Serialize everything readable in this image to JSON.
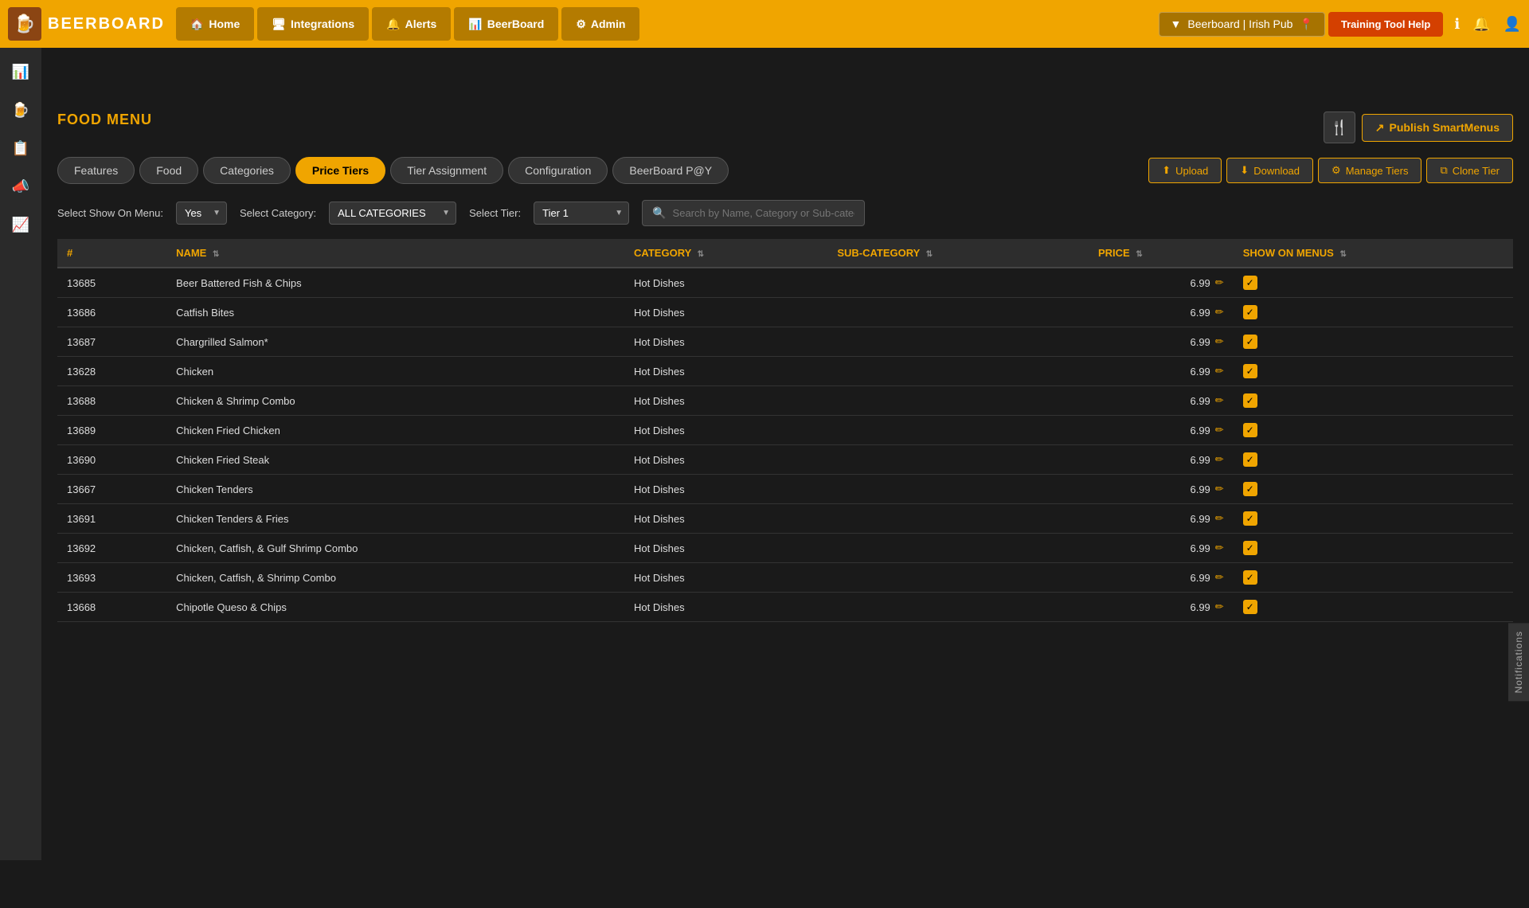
{
  "app": {
    "logo_text": "BEERBOARD",
    "logo_emoji": "🍺"
  },
  "nav": {
    "items": [
      {
        "id": "home",
        "label": "Home",
        "icon": "🏠",
        "active": false
      },
      {
        "id": "integrations",
        "label": "Integrations",
        "icon": "🖥",
        "active": false
      },
      {
        "id": "alerts",
        "label": "Alerts",
        "icon": "🔔",
        "active": false
      },
      {
        "id": "beerboard",
        "label": "BeerBoard",
        "icon": "📊",
        "active": false
      },
      {
        "id": "admin",
        "label": "Admin",
        "icon": "⚙",
        "active": false
      }
    ],
    "venue": "Beerboard | Irish Pub",
    "training_btn": "Training Tool Help",
    "icon_info": "ℹ",
    "icon_bell": "🔔",
    "icon_user": "👤"
  },
  "sidebar": {
    "items": [
      {
        "id": "analytics",
        "icon": "📊"
      },
      {
        "id": "beer",
        "icon": "🍺"
      },
      {
        "id": "reports",
        "icon": "📋"
      },
      {
        "id": "megaphone",
        "icon": "📣"
      },
      {
        "id": "chart",
        "icon": "📈"
      }
    ]
  },
  "page": {
    "title": "FOOD MENU",
    "publish_btn": "Publish SmartMenus",
    "fork_icon": "🍴"
  },
  "tabs": [
    {
      "id": "features",
      "label": "Features",
      "active": false
    },
    {
      "id": "food",
      "label": "Food",
      "active": false
    },
    {
      "id": "categories",
      "label": "Categories",
      "active": false
    },
    {
      "id": "price-tiers",
      "label": "Price Tiers",
      "active": true
    },
    {
      "id": "tier-assignment",
      "label": "Tier Assignment",
      "active": false
    },
    {
      "id": "configuration",
      "label": "Configuration",
      "active": false
    },
    {
      "id": "beerboard-pay",
      "label": "BeerBoard P@Y",
      "active": false
    }
  ],
  "actions": {
    "upload": "Upload",
    "download": "Download",
    "manage_tiers": "Manage Tiers",
    "clone_tier": "Clone Tier"
  },
  "filters": {
    "show_on_menu_label": "Select Show On Menu:",
    "show_on_menu_value": "Yes",
    "category_label": "Select Category:",
    "category_value": "ALL CATEGORIES",
    "tier_label": "Select Tier:",
    "tier_value": "Tier 1",
    "search_placeholder": "Search by Name, Category or Sub-category"
  },
  "table": {
    "columns": [
      {
        "id": "number",
        "label": "#"
      },
      {
        "id": "name",
        "label": "NAME"
      },
      {
        "id": "category",
        "label": "CATEGORY"
      },
      {
        "id": "sub_category",
        "label": "SUB-CATEGORY"
      },
      {
        "id": "price",
        "label": "PRICE"
      },
      {
        "id": "show_on_menus",
        "label": "SHOW ON MENUS"
      }
    ],
    "rows": [
      {
        "id": "13685",
        "name": "Beer Battered Fish & Chips",
        "category": "Hot Dishes",
        "sub_category": "",
        "price": "6.99",
        "show": true
      },
      {
        "id": "13686",
        "name": "Catfish Bites",
        "category": "Hot Dishes",
        "sub_category": "",
        "price": "6.99",
        "show": true
      },
      {
        "id": "13687",
        "name": "Chargrilled Salmon*",
        "category": "Hot Dishes",
        "sub_category": "",
        "price": "6.99",
        "show": true
      },
      {
        "id": "13628",
        "name": "Chicken",
        "category": "Hot Dishes",
        "sub_category": "",
        "price": "6.99",
        "show": true
      },
      {
        "id": "13688",
        "name": "Chicken & Shrimp Combo",
        "category": "Hot Dishes",
        "sub_category": "",
        "price": "6.99",
        "show": true
      },
      {
        "id": "13689",
        "name": "Chicken Fried Chicken",
        "category": "Hot Dishes",
        "sub_category": "",
        "price": "6.99",
        "show": true
      },
      {
        "id": "13690",
        "name": "Chicken Fried Steak",
        "category": "Hot Dishes",
        "sub_category": "",
        "price": "6.99",
        "show": true
      },
      {
        "id": "13667",
        "name": "Chicken Tenders",
        "category": "Hot Dishes",
        "sub_category": "",
        "price": "6.99",
        "show": true
      },
      {
        "id": "13691",
        "name": "Chicken Tenders & Fries",
        "category": "Hot Dishes",
        "sub_category": "",
        "price": "6.99",
        "show": true
      },
      {
        "id": "13692",
        "name": "Chicken, Catfish, & Gulf Shrimp Combo",
        "category": "Hot Dishes",
        "sub_category": "",
        "price": "6.99",
        "show": true
      },
      {
        "id": "13693",
        "name": "Chicken, Catfish, & Shrimp Combo",
        "category": "Hot Dishes",
        "sub_category": "",
        "price": "6.99",
        "show": true
      },
      {
        "id": "13668",
        "name": "Chipotle Queso & Chips",
        "category": "Hot Dishes",
        "sub_category": "",
        "price": "6.99",
        "show": true
      }
    ]
  },
  "notifications_tab": "Notifications"
}
